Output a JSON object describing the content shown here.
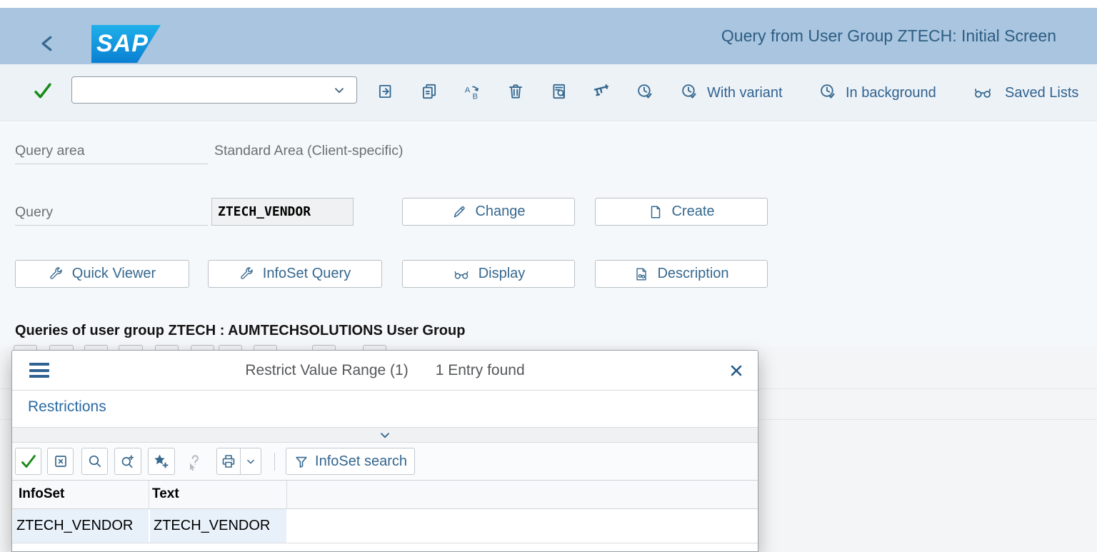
{
  "shell": {
    "logo_text": "SAP",
    "title": "Query from User Group ZTECH: Initial Screen"
  },
  "toolbar": {
    "command_value": "",
    "with_variant": "With variant",
    "in_background": "In background",
    "saved_lists": "Saved Lists"
  },
  "form": {
    "query_area_label": "Query area",
    "query_area_value": "Standard Area (Client-specific)",
    "query_label": "Query",
    "query_value": "ZTECH_VENDOR",
    "change": "Change",
    "create": "Create",
    "quick_viewer": "Quick Viewer",
    "infoset_query": "InfoSet Query",
    "display": "Display",
    "description": "Description"
  },
  "section": {
    "heading": "Queries of user group ZTECH : AUMTECHSOLUTIONS User Group"
  },
  "dialog": {
    "title": "Restrict Value Range (1)",
    "status": "1 Entry found",
    "restrictions": "Restrictions",
    "infoset_search": "InfoSet search",
    "table": {
      "columns": [
        "InfoSet",
        "Text"
      ],
      "rows": [
        {
          "infoset": "ZTECH_VENDOR",
          "text": "ZTECH_VENDOR"
        }
      ]
    }
  },
  "icons": {
    "back": "chevron-left",
    "enter_check": "green-checkmark",
    "command_dropdown": "chevron-down",
    "open_query": "page-with-arrow",
    "copy_query": "stacked-pages",
    "rename_query": "a-to-b-arrow",
    "delete_query": "trash-can",
    "display_list": "document-magnifier",
    "measure": "caliper",
    "execute": "clock-checkmark",
    "saved_lists": "glasses",
    "change": "pencil",
    "create": "blank-page",
    "quick_viewer": "wrench",
    "infoset_query": "wrench",
    "display": "glasses",
    "description": "document-glasses",
    "dialog_menu": "hamburger",
    "dialog_close": "x",
    "confirm": "green-checkmark",
    "cancel": "boxed-x",
    "find": "magnifier",
    "find_next": "magnifier-plus",
    "favorites": "star-plus",
    "help": "hand-question",
    "print": "printer",
    "print_dropdown": "chevron-down",
    "collapse": "chevron-down",
    "infoset_search": "funnel"
  },
  "colors": {
    "header_bg": "#a9c5df",
    "title_text": "#2d5d84",
    "toolbar_bg": "#edf2f7",
    "icon_blue": "#35688f",
    "accent_green": "#168a16",
    "sap_logo_blue": "#0d9de0",
    "content_bg": "#f5f8fa",
    "row_highlight": "#e8f0f9",
    "link_blue": "#2b6ba3"
  }
}
